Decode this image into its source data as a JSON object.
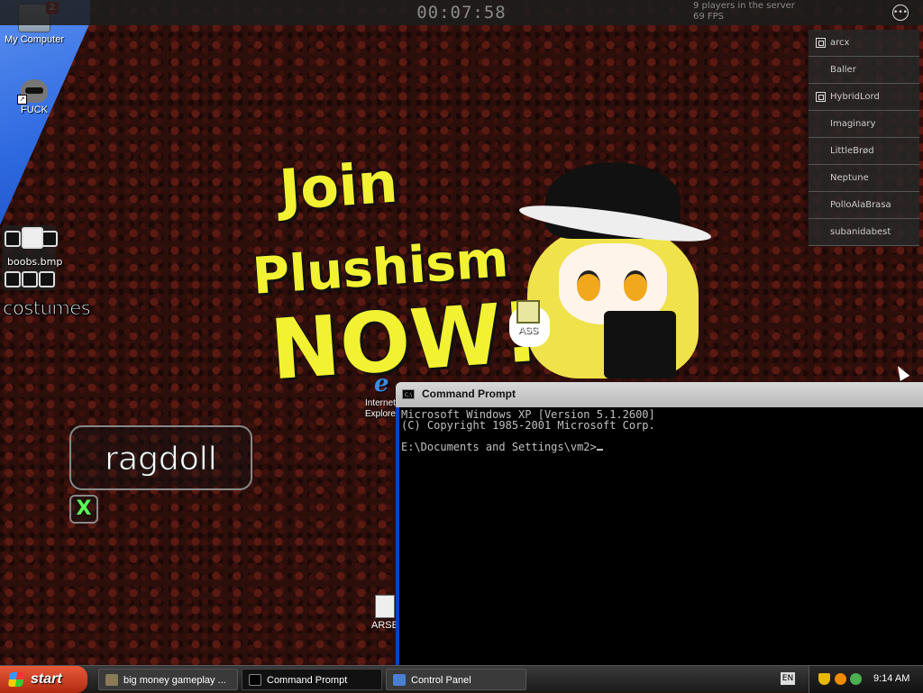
{
  "hud": {
    "timer": "00:07:58",
    "players_line": "9 players in the server",
    "fps_line": "69 FPS",
    "menu_icon": "ellipsis-circle-icon"
  },
  "players": [
    {
      "name": "arcx",
      "badge": true
    },
    {
      "name": "Baller",
      "badge": false
    },
    {
      "name": "HybridLord",
      "badge": true
    },
    {
      "name": "Imaginary",
      "badge": false
    },
    {
      "name": "LittleBrød",
      "badge": false
    },
    {
      "name": "Neptune",
      "badge": false
    },
    {
      "name": "PolloAlaBrasa",
      "badge": false
    },
    {
      "name": "subanidabest",
      "badge": false
    }
  ],
  "desktop": {
    "my_computer": "My Computer",
    "my_computer_badge": "2",
    "raccoon_icon": "FUCK",
    "boob_label": "boobs.bmp",
    "costumes": "costumes",
    "ragdoll": "ragdoll",
    "close_x": "X",
    "ass_icon": "ASS",
    "ie_icon": "Internet Explorer",
    "arse_icon": "ARSE"
  },
  "poster": {
    "line1": "Join",
    "line2": "Plushism",
    "line3": "NOW!"
  },
  "cmd": {
    "title": "Command Prompt",
    "line1": "Microsoft Windows XP [Version 5.1.2600]",
    "line2": "(C) Copyright 1985-2001 Microsoft Corp.",
    "prompt": "E:\\Documents and Settings\\vm2>"
  },
  "taskbar": {
    "start": "start",
    "tasks": [
      {
        "label": "big money gameplay ...",
        "icon": "game-icon",
        "active": false
      },
      {
        "label": "Command Prompt",
        "icon": "cmd-icon",
        "active": true
      },
      {
        "label": "Control Panel",
        "icon": "control-panel-icon",
        "active": false
      }
    ],
    "lang": "EN",
    "clock": "9:14 AM"
  }
}
